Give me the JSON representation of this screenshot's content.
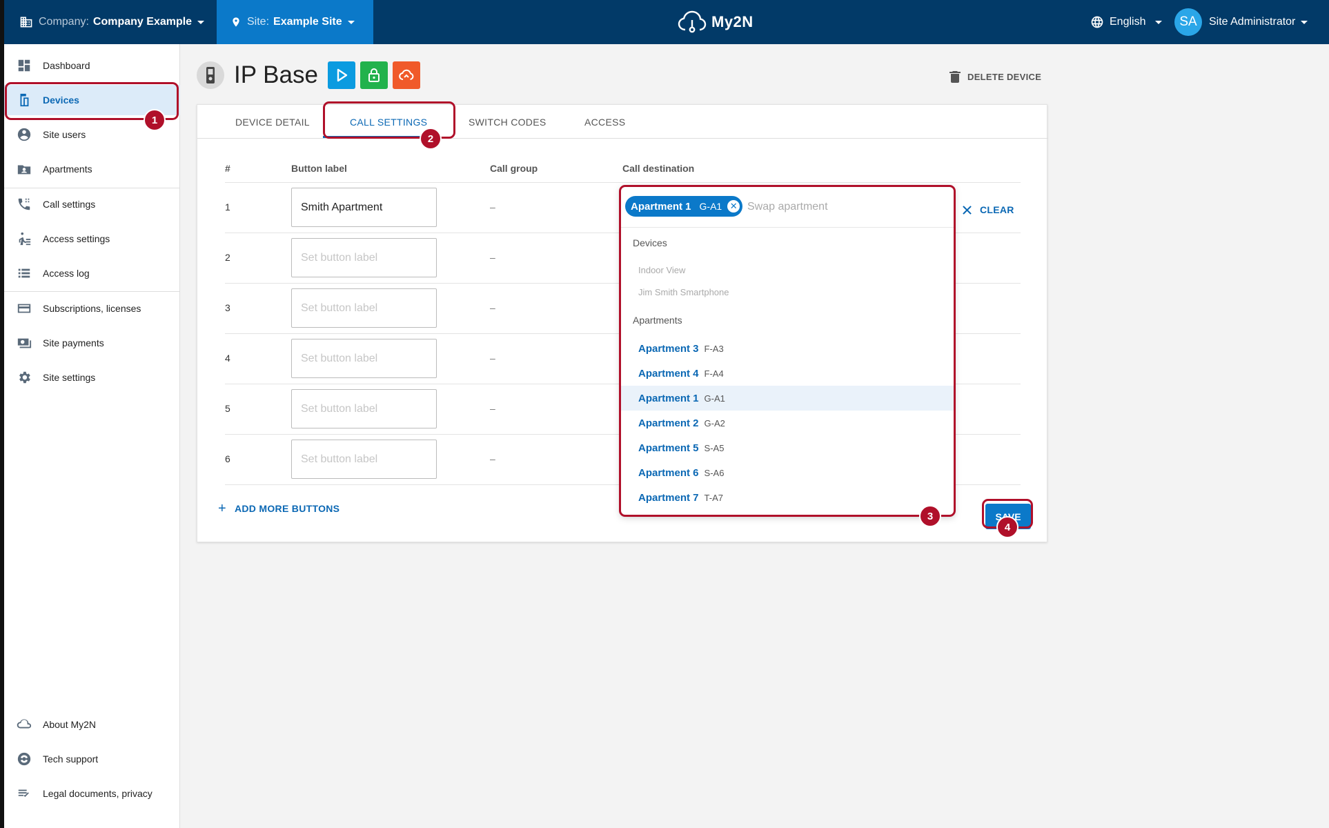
{
  "topbar": {
    "company_label": "Company:",
    "company_name": "Company Example",
    "site_label": "Site:",
    "site_name": "Example Site",
    "brand": "My2N",
    "language": "English",
    "user_initials": "SA",
    "user_name": "Site Administrator"
  },
  "sidebar": {
    "items": [
      {
        "label": "Dashboard",
        "icon": "dashboard-icon"
      },
      {
        "label": "Devices",
        "icon": "device-icon",
        "active": true
      },
      {
        "label": "Site users",
        "icon": "globe-users-icon"
      },
      {
        "label": "Apartments",
        "icon": "apartment-icon"
      },
      {
        "label": "Call settings",
        "icon": "call-settings-icon"
      },
      {
        "label": "Access settings",
        "icon": "access-icon"
      },
      {
        "label": "Access log",
        "icon": "list-icon"
      },
      {
        "label": "Subscriptions, licenses",
        "icon": "card-icon"
      },
      {
        "label": "Site payments",
        "icon": "payments-icon"
      },
      {
        "label": "Site settings",
        "icon": "gear-icon"
      }
    ],
    "bottom": [
      {
        "label": "About My2N",
        "icon": "cloud-icon"
      },
      {
        "label": "Tech support",
        "icon": "support-icon"
      },
      {
        "label": "Legal documents, privacy",
        "icon": "legal-icon"
      }
    ]
  },
  "device": {
    "title": "IP Base",
    "delete_label": "DELETE DEVICE",
    "feature_colors": [
      "#0b9be0",
      "#22b24c",
      "#f05a2a"
    ]
  },
  "tabs": [
    "DEVICE DETAIL",
    "CALL SETTINGS",
    "SWITCH CODES",
    "ACCESS"
  ],
  "table": {
    "headers": {
      "num": "#",
      "label": "Button label",
      "group": "Call group",
      "dest": "Call destination"
    },
    "placeholder": "Set button label",
    "rows": [
      {
        "num": "1",
        "label": "Smith Apartment",
        "group": "–"
      },
      {
        "num": "2",
        "label": "",
        "group": "–"
      },
      {
        "num": "3",
        "label": "",
        "group": "–"
      },
      {
        "num": "4",
        "label": "",
        "group": "–"
      },
      {
        "num": "5",
        "label": "",
        "group": "–"
      },
      {
        "num": "6",
        "label": "",
        "group": "–"
      }
    ]
  },
  "dropdown": {
    "selected": {
      "name": "Apartment 1",
      "code": "G-A1"
    },
    "search_placeholder": "Swap apartment",
    "devices_heading": "Devices",
    "devices": [
      "Indoor View",
      "Jim Smith Smartphone"
    ],
    "apartments_heading": "Apartments",
    "apartments": [
      {
        "name": "Apartment 3",
        "code": "F-A3"
      },
      {
        "name": "Apartment 4",
        "code": "F-A4"
      },
      {
        "name": "Apartment 1",
        "code": "G-A1",
        "highlighted": true
      },
      {
        "name": "Apartment 2",
        "code": "G-A2"
      },
      {
        "name": "Apartment 5",
        "code": "S-A5"
      },
      {
        "name": "Apartment 6",
        "code": "S-A6"
      },
      {
        "name": "Apartment 7",
        "code": "T-A7"
      }
    ]
  },
  "actions": {
    "clear": "CLEAR",
    "add_more": "ADD MORE BUTTONS",
    "save": "SAVE"
  },
  "badges": [
    "1",
    "2",
    "3",
    "4"
  ],
  "colors": {
    "navy": "#023a68",
    "accent": "#0b79c9",
    "highlight": "#b0102a"
  }
}
